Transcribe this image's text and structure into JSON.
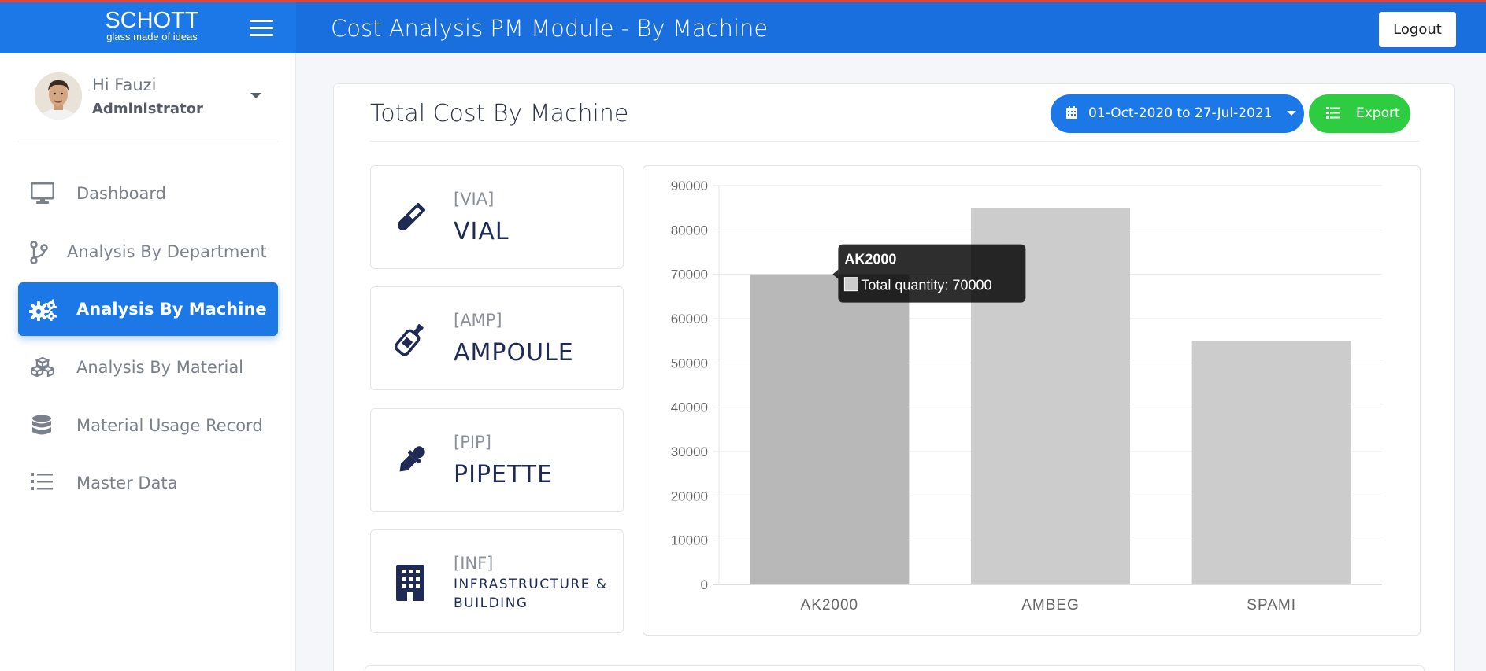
{
  "brand": {
    "name": "SCHOTT",
    "tagline": "glass made of ideas"
  },
  "header": {
    "title": "Cost Analysis PM Module - By Machine",
    "logout_label": "Logout"
  },
  "user": {
    "greeting": "Hi Fauzi",
    "role": "Administrator"
  },
  "sidebar": {
    "items": [
      {
        "label": "Dashboard",
        "icon": "monitor-icon"
      },
      {
        "label": "Analysis By Department",
        "icon": "branch-icon"
      },
      {
        "label": "Analysis By Machine",
        "icon": "gears-icon",
        "active": true
      },
      {
        "label": "Analysis By Material",
        "icon": "cubes-icon"
      },
      {
        "label": "Material Usage Record",
        "icon": "database-icon"
      },
      {
        "label": "Master Data",
        "icon": "list-icon"
      }
    ]
  },
  "main": {
    "title": "Total Cost By Machine",
    "date_range": "01-Oct-2020 to 27-Jul-2021",
    "export_label": "Export",
    "tiles": [
      {
        "code": "[VIA]",
        "name": "VIAL",
        "icon": "test-tube-icon"
      },
      {
        "code": "[AMP]",
        "name": "AMPOULE",
        "icon": "bottle-icon"
      },
      {
        "code": "[PIP]",
        "name": "PIPETTE",
        "icon": "eyedropper-icon"
      },
      {
        "code": "[INF]",
        "name": "INFRASTRUCTURE & BUILDING",
        "icon": "building-icon"
      }
    ]
  },
  "colors": {
    "primary": "#1b78e6",
    "export": "#2ecc40",
    "bar": "#cccccc",
    "bar_hover": "#b8b8b8",
    "navy": "#1f2a55"
  },
  "chart_data": {
    "type": "bar",
    "categories": [
      "AK2000",
      "AMBEG",
      "SPAMI"
    ],
    "series": [
      {
        "name": "Total quantity",
        "values": [
          70000,
          85000,
          55000
        ]
      }
    ],
    "ylim": [
      0,
      90000
    ],
    "yticks": [
      0,
      10000,
      20000,
      30000,
      40000,
      50000,
      60000,
      70000,
      80000,
      90000
    ],
    "xlabel": "",
    "ylabel": "",
    "grid": true,
    "tooltip": {
      "title": "AK2000",
      "label": "Total quantity: 70000"
    }
  }
}
